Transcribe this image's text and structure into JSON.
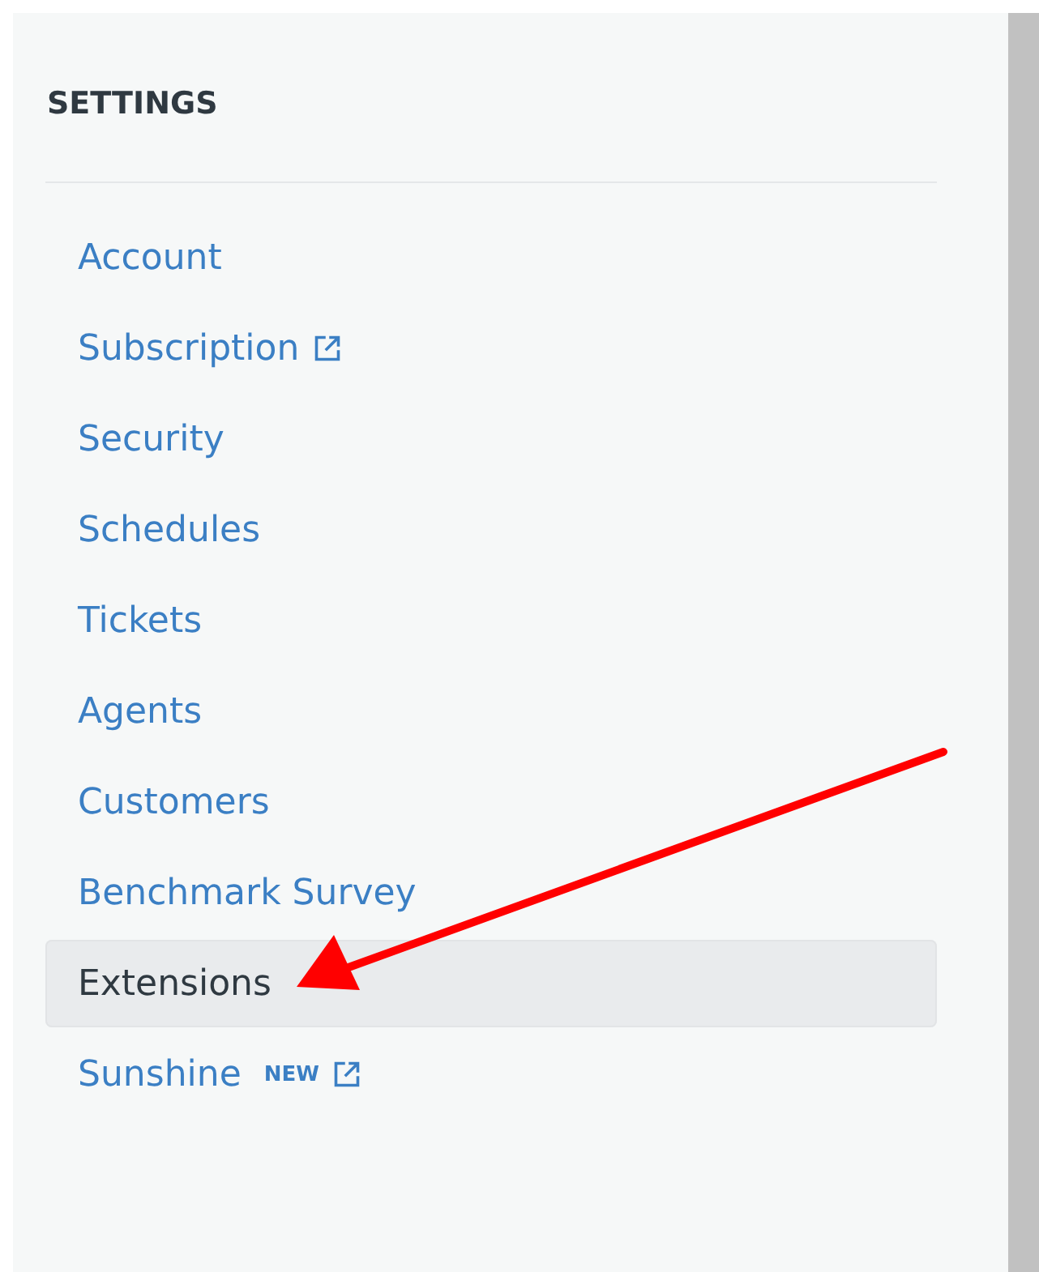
{
  "sidebar": {
    "heading": "SETTINGS",
    "items": [
      {
        "label": "Account",
        "selected": false,
        "external": false
      },
      {
        "label": "Subscription",
        "selected": false,
        "external": true
      },
      {
        "label": "Security",
        "selected": false,
        "external": false
      },
      {
        "label": "Schedules",
        "selected": false,
        "external": false
      },
      {
        "label": "Tickets",
        "selected": false,
        "external": false
      },
      {
        "label": "Agents",
        "selected": false,
        "external": false
      },
      {
        "label": "Customers",
        "selected": false,
        "external": false
      },
      {
        "label": "Benchmark Survey",
        "selected": false,
        "external": false
      },
      {
        "label": "Extensions",
        "selected": true,
        "external": false
      },
      {
        "label": "Sunshine",
        "selected": false,
        "external": true,
        "badge": "NEW"
      }
    ]
  }
}
